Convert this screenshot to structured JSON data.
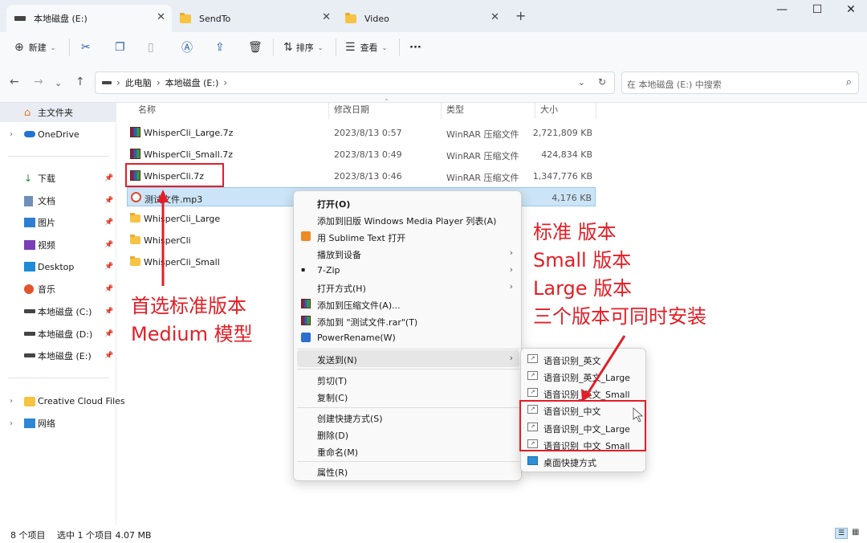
{
  "tabs": [
    {
      "label": "本地磁盘 (E:)",
      "icon": "drive-icon",
      "active": true
    },
    {
      "label": "SendTo",
      "icon": "folder-icon",
      "active": false
    },
    {
      "label": "Video",
      "icon": "folder-icon",
      "active": false
    }
  ],
  "window_controls": {
    "minimize": "—",
    "maximize": "☐",
    "close": "✕"
  },
  "toolbar": {
    "new_label": "新建",
    "sort_label": "排序",
    "view_label": "查看",
    "more_label": "···"
  },
  "address": {
    "crumbs": [
      "此电脑",
      "本地磁盘 (E:)"
    ],
    "search_placeholder": "在 本地磁盘 (E:) 中搜索"
  },
  "sidebar": {
    "home": "主文件夹",
    "onedrive": "OneDrive",
    "quick": [
      {
        "label": "下载",
        "icon": "download-icon"
      },
      {
        "label": "文档",
        "icon": "document-icon"
      },
      {
        "label": "图片",
        "icon": "picture-icon"
      },
      {
        "label": "视频",
        "icon": "video-icon"
      },
      {
        "label": "Desktop",
        "icon": "desktop-icon"
      },
      {
        "label": "音乐",
        "icon": "music-icon"
      },
      {
        "label": "本地磁盘 (C:)",
        "icon": "drive-icon"
      },
      {
        "label": "本地磁盘 (D:)",
        "icon": "drive-icon"
      },
      {
        "label": "本地磁盘 (E:)",
        "icon": "drive-icon"
      }
    ],
    "creative_cloud": "Creative Cloud Files",
    "network": "网络"
  },
  "columns": {
    "name": "名称",
    "date": "修改日期",
    "type": "类型",
    "size": "大小"
  },
  "files": [
    {
      "name": "WhisperCli_Large.7z",
      "date": "2023/8/13 0:57",
      "type": "WinRAR 压缩文件",
      "size": "2,721,809 KB",
      "icon": "rar-icon"
    },
    {
      "name": "WhisperCli_Small.7z",
      "date": "2023/8/13 0:49",
      "type": "WinRAR 压缩文件",
      "size": "424,834 KB",
      "icon": "rar-icon"
    },
    {
      "name": "WhisperCli.7z",
      "date": "2023/8/13 0:46",
      "type": "WinRAR 压缩文件",
      "size": "1,347,776 KB",
      "icon": "rar-icon"
    },
    {
      "name": "测试文件.mp3",
      "date": "",
      "type": "",
      "size": "4,176 KB",
      "icon": "mp3-icon",
      "selected": true
    },
    {
      "name": "WhisperCli_Large",
      "date": "",
      "type": "",
      "size": "",
      "icon": "folder-icon"
    },
    {
      "name": "WhisperCli",
      "date": "",
      "type": "",
      "size": "",
      "icon": "folder-icon"
    },
    {
      "name": "WhisperCli_Small",
      "date": "",
      "type": "",
      "size": "",
      "icon": "folder-icon"
    }
  ],
  "context_menu": {
    "open": "打开(O)",
    "add_wmp": "添加到旧版 Windows Media Player 列表(A)",
    "sublime": "用 Sublime Text 打开",
    "cast": "播放到设备",
    "zip7": "7-Zip",
    "open_with": "打开方式(H)",
    "add_archive": "添加到压缩文件(A)...",
    "add_rar": "添加到 \"测试文件.rar\"(T)",
    "powerrename": "PowerRename(W)",
    "send_to": "发送到(N)",
    "cut": "剪切(T)",
    "copy": "复制(C)",
    "shortcut": "创建快捷方式(S)",
    "delete": "删除(D)",
    "rename": "重命名(M)",
    "properties": "属性(R)"
  },
  "send_to_menu": [
    "语音识别_英文",
    "语音识别_英文_Large",
    "语音识别_英文_Small",
    "语音识别_中文",
    "语音识别_中文_Large",
    "语音识别_中文_Small",
    "桌面快捷方式"
  ],
  "annotations": {
    "left_line1": "首选标准版本",
    "left_line2": "Medium 模型",
    "right_line1": "标准 版本",
    "right_line2": "Small 版本",
    "right_line3": "Large 版本",
    "right_line4": "三个版本可同时安装"
  },
  "status": {
    "count": "8 个项目",
    "selection": "选中 1 个项目  4.07 MB"
  },
  "colors": {
    "accent": "#0067c0",
    "annotation_red": "#e21e26",
    "selection": "#cce4f7"
  }
}
